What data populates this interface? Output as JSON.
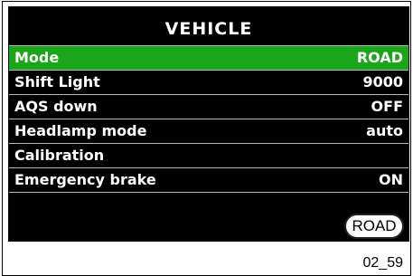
{
  "screen": {
    "title": "VEHICLE",
    "badge": "ROAD"
  },
  "menu": {
    "items": [
      {
        "label": "Mode",
        "value": "ROAD",
        "selected": true
      },
      {
        "label": "Shift Light",
        "value": "9000",
        "selected": false
      },
      {
        "label": "AQS down",
        "value": "OFF",
        "selected": false
      },
      {
        "label": "Headlamp mode",
        "value": "auto",
        "selected": false
      },
      {
        "label": "Calibration",
        "value": "",
        "selected": false
      },
      {
        "label": "Emergency brake",
        "value": "ON",
        "selected": false
      }
    ]
  },
  "footer": {
    "figure_id": "02_59"
  },
  "colors": {
    "screen_bg": "#000000",
    "selected_row": "#1aa61a",
    "text": "#ffffff"
  }
}
